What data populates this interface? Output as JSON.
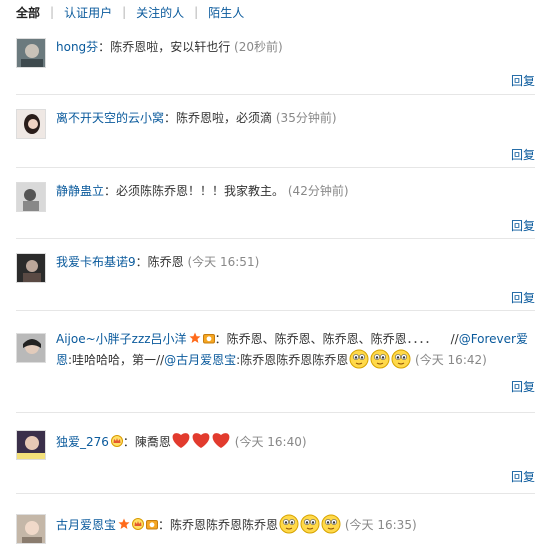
{
  "tabs": [
    "全部",
    "认证用户",
    "关注的人",
    "陌生人"
  ],
  "reply_label": "回复",
  "comments": [
    {
      "user": "hong芬",
      "text": "陈乔恩啦，安以轩也行",
      "time": "(20秒前)"
    },
    {
      "user": "离不开天空的云小窝",
      "text": "陈乔恩啦，必须滴",
      "time": "(35分钟前)"
    },
    {
      "user": "静静蛊立",
      "text": "必须陈陈乔恩！！！我家教主。",
      "time": "(42分钟前)"
    },
    {
      "user": "我爱卡布基诺9",
      "text": "陈乔恩",
      "time": "(今天 16:51)"
    },
    {
      "user": "Aijoe~小胖子zzz吕小洋",
      "text1": "陈乔恩、陈乔恩、陈乔恩、陈乔恩．．．．",
      "slashes1": "//",
      "mention1": "@Forever爱",
      "mention1b": "恩",
      "text2": ":哇哈哈哈，第一",
      "slashes2": "//",
      "mention2": "@古月爱恩宝",
      "text3": ":陈乔恩陈乔恩陈乔恩",
      "time": "(今天 16:42)"
    },
    {
      "user": "独爱_276",
      "text": "陳喬恩",
      "time": "(今天 16:40)"
    },
    {
      "user": "古月爱恩宝",
      "text": "陈乔恩陈乔恩陈乔恩",
      "time": "(今天 16:35)"
    }
  ],
  "colors": {
    "link": "#0a5a9c",
    "text": "#333333",
    "time": "#888888",
    "divider": "#e6e6e6"
  },
  "icons": [
    "star-badge-icon",
    "camera-badge-icon",
    "crown-badge-icon",
    "smiley-emoticon-icon",
    "heart-emoticon-icon"
  ]
}
